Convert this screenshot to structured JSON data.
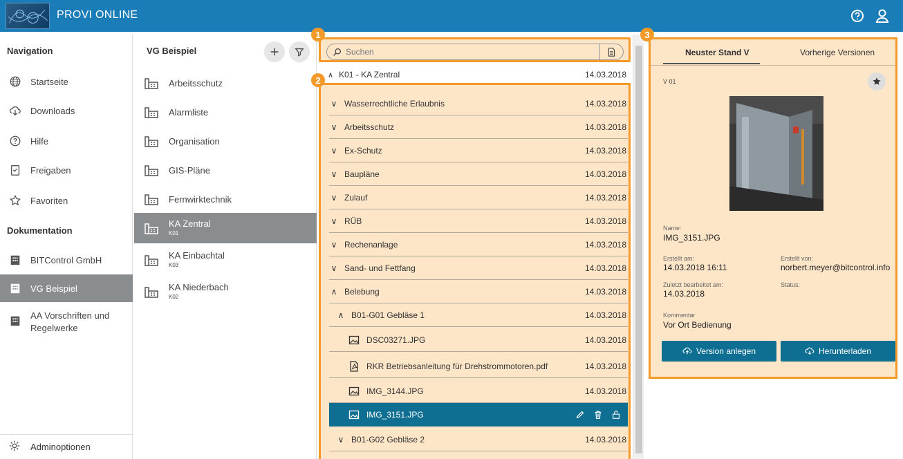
{
  "app": {
    "title": "PROVI ONLINE"
  },
  "nav": {
    "section1": "Navigation",
    "items": [
      {
        "label": "Startseite",
        "icon": "globe-icon"
      },
      {
        "label": "Downloads",
        "icon": "cloud-download-icon"
      },
      {
        "label": "Hilfe",
        "icon": "help-icon"
      },
      {
        "label": "Freigaben",
        "icon": "checklist-icon"
      },
      {
        "label": "Favoriten",
        "icon": "star-icon"
      }
    ],
    "section2": "Dokumentation",
    "docs": [
      {
        "label": "BITControl GmbH"
      },
      {
        "label": "VG Beispiel"
      },
      {
        "label": "AA Vorschriften und Regelwerke"
      }
    ],
    "admin": "Adminoptionen"
  },
  "vg": {
    "title": "VG Beispiel",
    "items": [
      {
        "label": "Arbeitsschutz",
        "sub": ""
      },
      {
        "label": "Alarmliste",
        "sub": ""
      },
      {
        "label": "Organisation",
        "sub": ""
      },
      {
        "label": "GIS-Pläne",
        "sub": ""
      },
      {
        "label": "Fernwirktechnik",
        "sub": ""
      },
      {
        "label": "KA Zentral",
        "sub": "K01"
      },
      {
        "label": "KA Einbachtal",
        "sub": "K03"
      },
      {
        "label": "KA Niederbach",
        "sub": "K02"
      }
    ]
  },
  "search": {
    "placeholder": "Suchen"
  },
  "tree": {
    "root": {
      "label": "K01 - KA Zentral",
      "date": "14.03.2018"
    },
    "rows": [
      {
        "label": "Wasserrechtliche Erlaubnis",
        "date": "14.03.2018"
      },
      {
        "label": "Arbeitsschutz",
        "date": "14.03.2018"
      },
      {
        "label": "Ex-Schutz",
        "date": "14.03.2018"
      },
      {
        "label": "Baupläne",
        "date": "14.03.2018"
      },
      {
        "label": "Zulauf",
        "date": "14.03.2018"
      },
      {
        "label": "RÜB",
        "date": "14.03.2018"
      },
      {
        "label": "Rechenanlage",
        "date": "14.03.2018"
      },
      {
        "label": "Sand- und Fettfang",
        "date": "14.03.2018"
      },
      {
        "label": "Belebung",
        "date": "14.03.2018"
      },
      {
        "label": "B01-G01 Gebläse 1",
        "date": "14.03.2018"
      },
      {
        "label": "DSC03271.JPG",
        "date": "14.03.2018"
      },
      {
        "label": "RKR Betriebsanleitung für Drehstrommotoren.pdf",
        "date": "14.03.2018"
      },
      {
        "label": "IMG_3144.JPG",
        "date": "14.03.2018"
      },
      {
        "label": "IMG_3151.JPG",
        "date": ""
      },
      {
        "label": "B01-G02 Gebläse 2",
        "date": "14.03.2018"
      }
    ]
  },
  "detail": {
    "tab_current": "Neuster Stand V",
    "tab_previous": "Vorherige Versionen",
    "version": "V 01",
    "name_label": "Name:",
    "name": "IMG_3151.JPG",
    "created_label": "Erstellt am:",
    "created": "14.03.2018 16:11",
    "created_by_label": "Erstellt von:",
    "created_by": "norbert.meyer@bitcontrol.info",
    "edited_label": "Zuletzt bearbeitet am:",
    "edited": "14.03.2018",
    "status_label": "Status:",
    "comment_label": "Kommentar",
    "comment": "Vor Ort Bedienung",
    "btn_version": "Version anlegen",
    "btn_download": "Herunterladen"
  },
  "badges": [
    "1",
    "2",
    "3"
  ],
  "colors": {
    "header": "#1b7db8",
    "highlight": "#f39a2a",
    "highlight_fill": "#fde5c8",
    "selected": "#0f6f93",
    "active_nav": "#8a8d90"
  }
}
